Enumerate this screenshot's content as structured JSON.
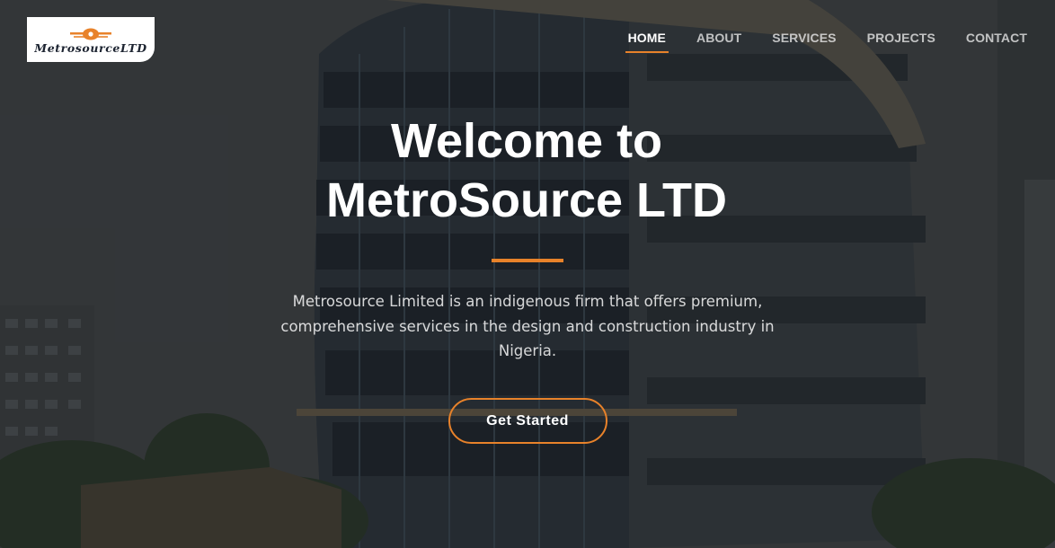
{
  "logo": {
    "text": "MetrosourceLTD",
    "mark": "logo-emblem-icon"
  },
  "nav": {
    "items": [
      {
        "label": "HOME",
        "active": true
      },
      {
        "label": "ABOUT",
        "active": false
      },
      {
        "label": "SERVICES",
        "active": false
      },
      {
        "label": "PROJECTS",
        "active": false
      },
      {
        "label": "CONTACT",
        "active": false
      }
    ]
  },
  "hero": {
    "title_line1": "Welcome to",
    "title_line2": "MetroSource LTD",
    "description": "Metrosource Limited is an indigenous firm that offers premium, comprehensive services in the design and construction industry in Nigeria.",
    "cta_label": "Get Started"
  },
  "colors": {
    "accent": "#e8822a",
    "text": "#ffffff",
    "nav_inactive": "rgba(255,255,255,0.7)"
  }
}
